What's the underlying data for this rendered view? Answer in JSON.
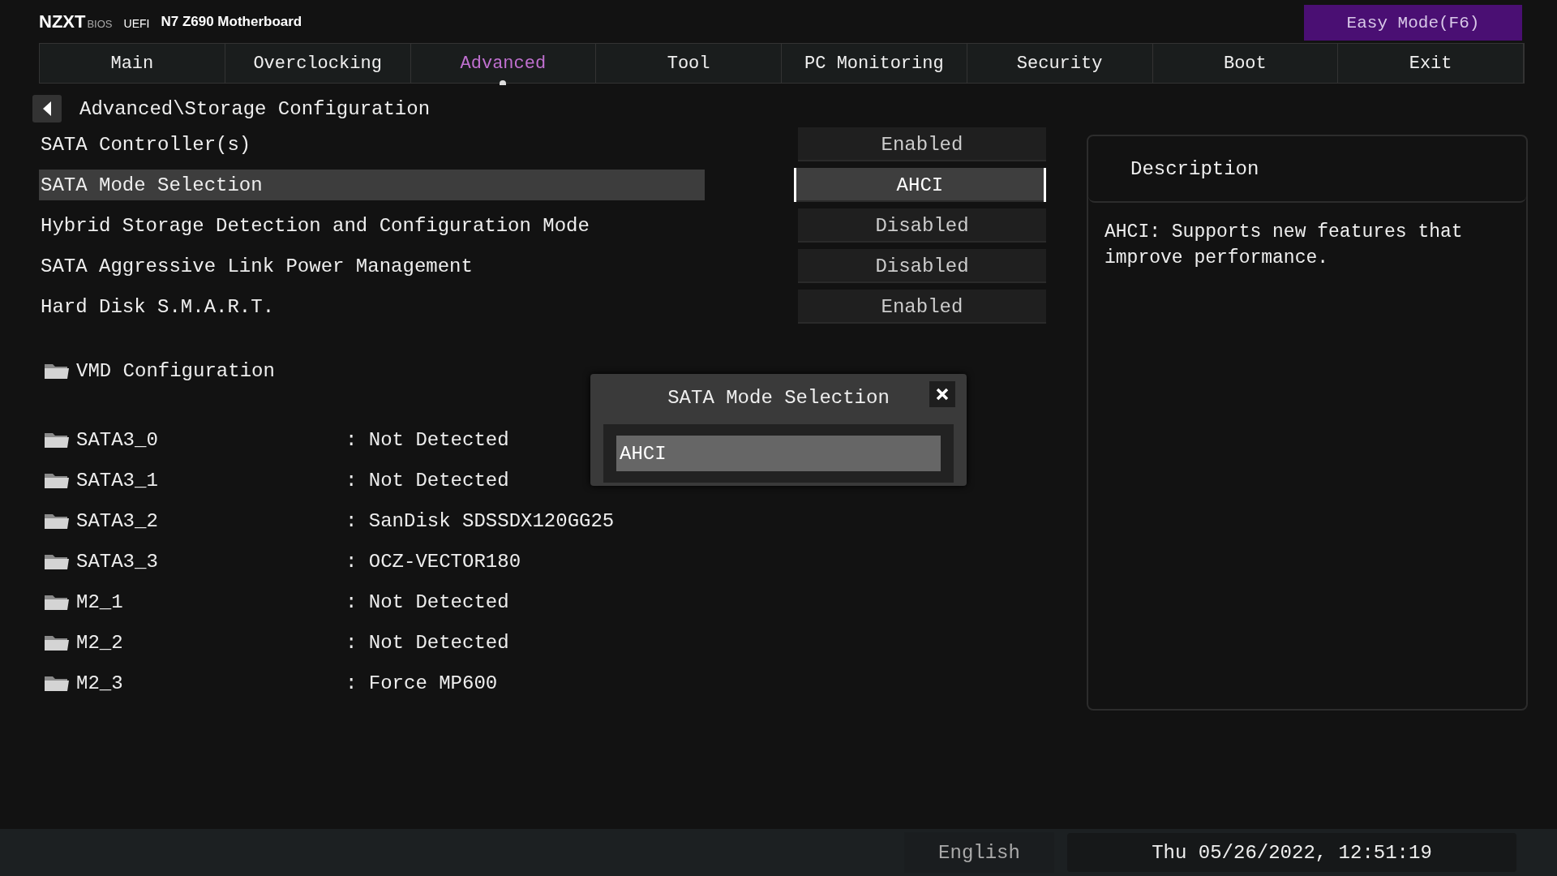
{
  "header": {
    "brand": "NZXT",
    "brand_sub": "BIOS",
    "uefi": "UEFI",
    "board": "N7 Z690 Motherboard",
    "mode_button": "Easy Mode(F6)"
  },
  "tabs": [
    {
      "label": "Main",
      "selected": false
    },
    {
      "label": "Overclocking",
      "selected": false
    },
    {
      "label": "Advanced",
      "selected": true
    },
    {
      "label": "Tool",
      "selected": false
    },
    {
      "label": "PC Monitoring",
      "selected": false
    },
    {
      "label": "Security",
      "selected": false
    },
    {
      "label": "Boot",
      "selected": false
    },
    {
      "label": "Exit",
      "selected": false
    }
  ],
  "breadcrumb": "Advanced\\Storage Configuration",
  "settings": [
    {
      "label": "SATA Controller(s)",
      "value": "Enabled",
      "selected": false
    },
    {
      "label": "SATA Mode Selection",
      "value": "AHCI",
      "selected": true
    },
    {
      "label": "Hybrid Storage Detection and Configuration Mode",
      "value": "Disabled",
      "selected": false
    },
    {
      "label": "SATA Aggressive Link Power Management",
      "value": "Disabled",
      "selected": false
    },
    {
      "label": "Hard Disk S.M.A.R.T.",
      "value": "Enabled",
      "selected": false
    }
  ],
  "submenu": {
    "label": "VMD Configuration"
  },
  "ports": [
    {
      "name": "SATA3_0",
      "value": ": Not Detected"
    },
    {
      "name": "SATA3_1",
      "value": ": Not Detected"
    },
    {
      "name": "SATA3_2",
      "value": ": SanDisk SDSSDX120GG25"
    },
    {
      "name": "SATA3_3",
      "value": ": OCZ-VECTOR180"
    },
    {
      "name": "M2_1",
      "value": ": Not Detected"
    },
    {
      "name": "M2_2",
      "value": ": Not Detected"
    },
    {
      "name": "M2_3",
      "value": ": Force MP600"
    }
  ],
  "dialog": {
    "title": "SATA Mode Selection",
    "options": [
      {
        "label": "AHCI",
        "selected": true
      }
    ]
  },
  "description": {
    "title": "Description",
    "text": "AHCI: Supports new features that improve performance."
  },
  "status_bar": {
    "language": "English",
    "datetime": "Thu 05/26/2022, 12:51:19"
  }
}
